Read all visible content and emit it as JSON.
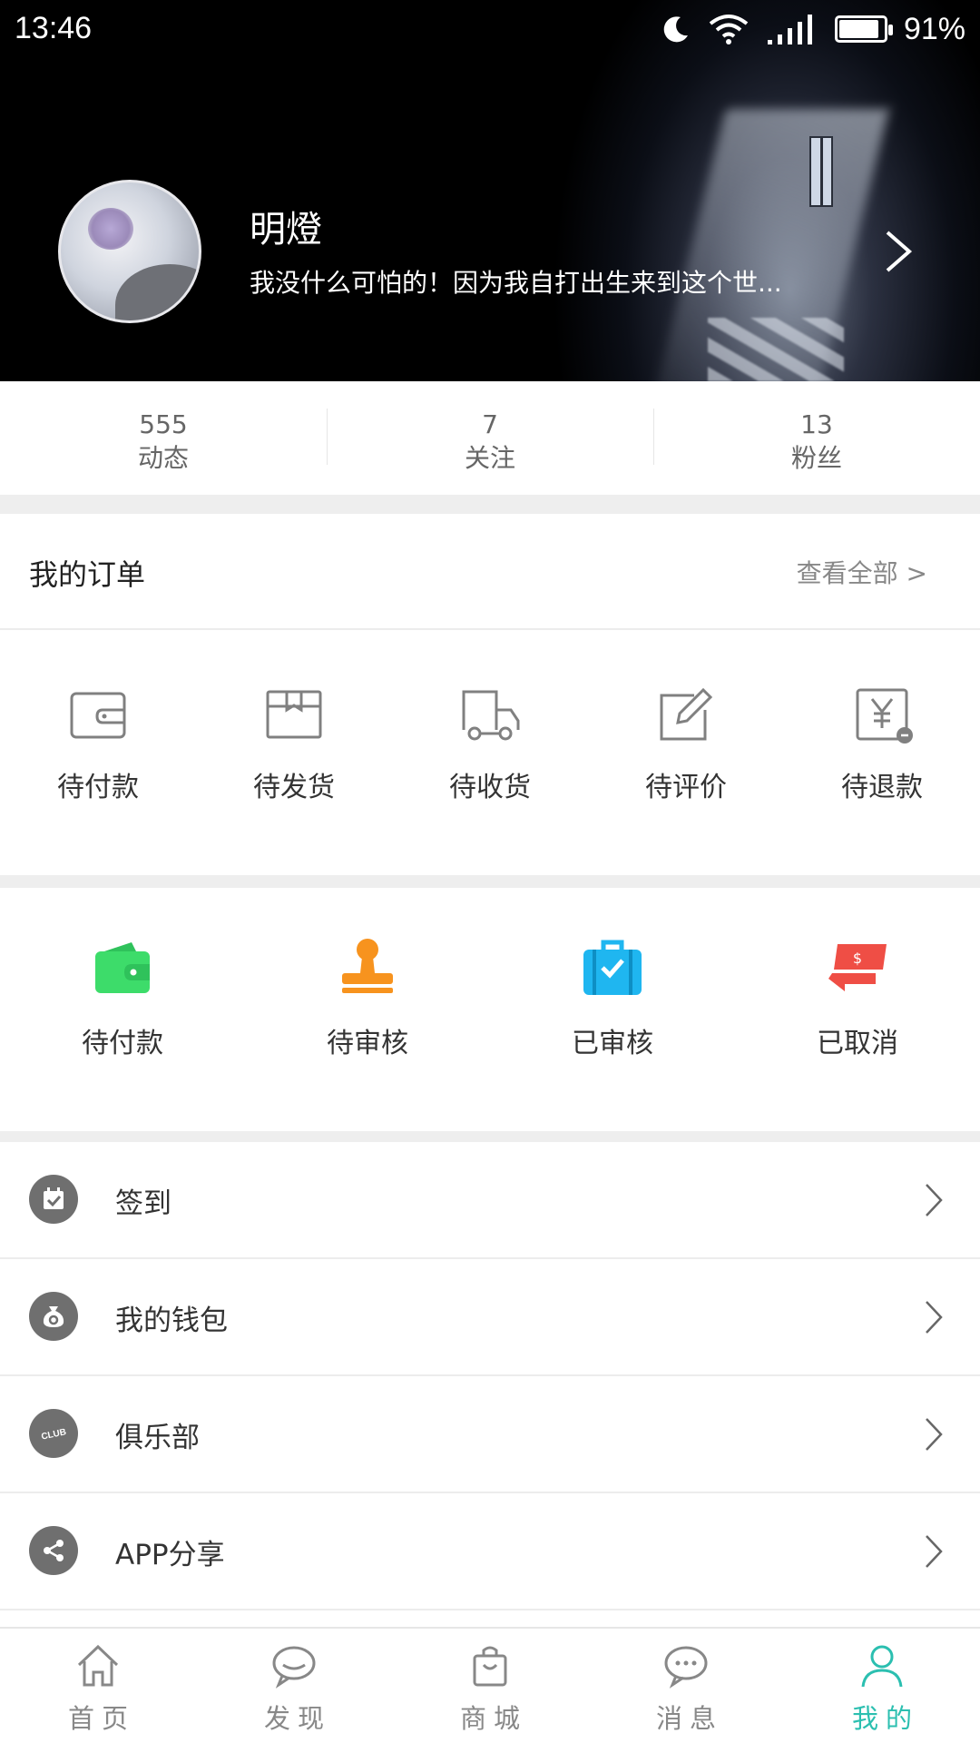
{
  "status_bar": {
    "time": "13:46",
    "battery": "91%",
    "battery_level": 0.91
  },
  "profile": {
    "name": "明燈",
    "bio": "我没什么可怕的！因为我自打出生来到这个世..."
  },
  "stats": [
    {
      "value": "555",
      "label": "动态"
    },
    {
      "value": "7",
      "label": "关注"
    },
    {
      "value": "13",
      "label": "粉丝"
    }
  ],
  "orders": {
    "title": "我的订单",
    "view_all": "查看全部 >",
    "items": [
      {
        "label": "待付款",
        "icon": "wallet-outline-icon"
      },
      {
        "label": "待发货",
        "icon": "box-outline-icon"
      },
      {
        "label": "待收货",
        "icon": "truck-outline-icon"
      },
      {
        "label": "待评价",
        "icon": "edit-outline-icon"
      },
      {
        "label": "待退款",
        "icon": "yen-refund-outline-icon"
      }
    ]
  },
  "status_items": [
    {
      "label": "待付款",
      "icon": "green-wallet-icon",
      "color": "#3ddc6a"
    },
    {
      "label": "待审核",
      "icon": "orange-stamp-icon",
      "color": "#f7931e"
    },
    {
      "label": "已审核",
      "icon": "blue-briefcase-check-icon",
      "color": "#1fb6f0"
    },
    {
      "label": "已取消",
      "icon": "red-refund-card-icon",
      "color": "#ef4e45"
    }
  ],
  "menu": [
    {
      "label": "签到",
      "icon": "calendar-check-icon"
    },
    {
      "label": "我的钱包",
      "icon": "money-bag-icon"
    },
    {
      "label": "俱乐部",
      "icon": "club-icon",
      "icon_text": "CLUB"
    },
    {
      "label": "APP分享",
      "icon": "share-icon"
    }
  ],
  "bottom_nav": [
    {
      "label": "首页",
      "icon": "home-icon"
    },
    {
      "label": "发现",
      "icon": "discover-chat-icon"
    },
    {
      "label": "商城",
      "icon": "shopping-bag-icon"
    },
    {
      "label": "消息",
      "icon": "message-icon"
    },
    {
      "label": "我的",
      "icon": "profile-icon",
      "active": true
    }
  ],
  "colors": {
    "accent": "#2bbfb0",
    "icon_gray": "#808080"
  }
}
